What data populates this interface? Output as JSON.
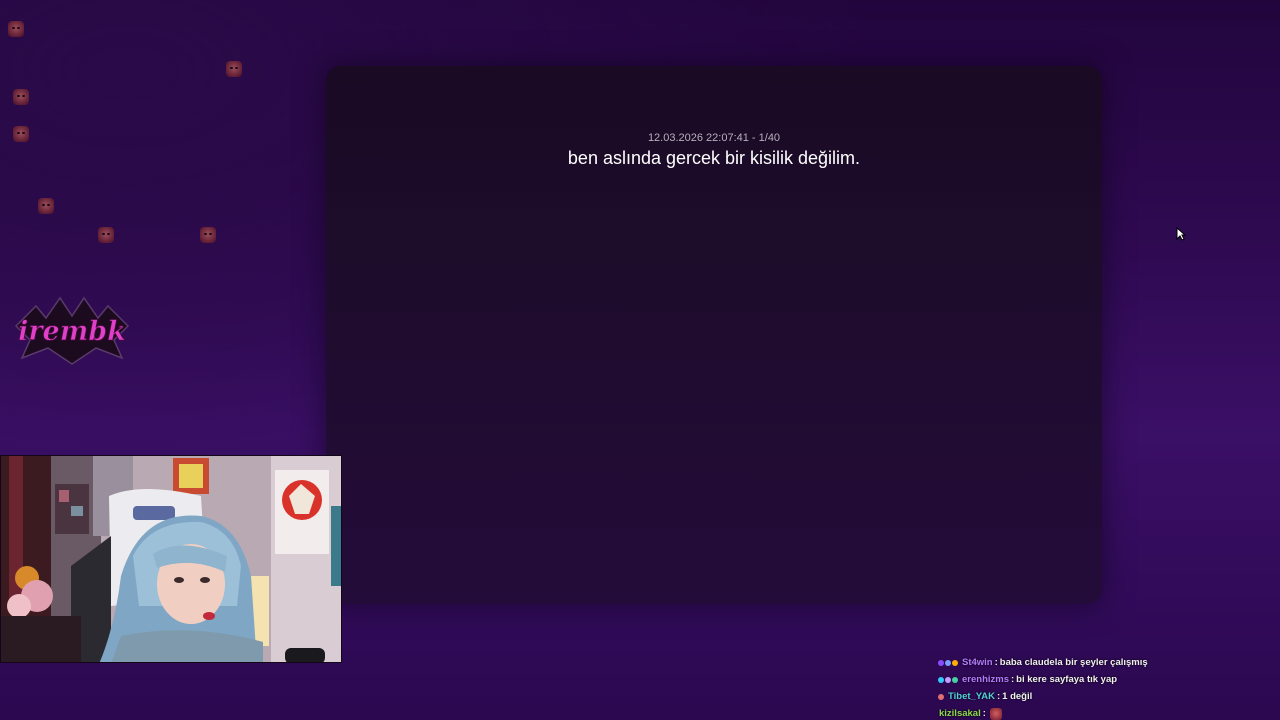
{
  "overlay": {
    "logo_text": "irembk",
    "emotes": [
      "emote-red-face"
    ]
  },
  "panel": {
    "meta": "12.03.2026 22:07:41 - 1/40",
    "message": "ben aslında gercek bir kisilik değilim."
  },
  "colors": {
    "background": "#2f0a52",
    "panel": "#1e0c2c",
    "logo": "#e040c8"
  },
  "chat": {
    "messages": [
      {
        "user": "St4win",
        "user_color": "#b47bff",
        "badges": [
          "#8a4dff",
          "#7aa0ff",
          "#ffb000"
        ],
        "separator": ":",
        "text": "baba claudela bir şeyler çalışmış"
      },
      {
        "user": "erenhizms",
        "user_color": "#b47bff",
        "badges": [
          "#35c9ff",
          "#c0a0ff",
          "#48d0a0"
        ],
        "separator": ":",
        "text": "bi kere sayfaya tık yap"
      },
      {
        "user": "Tibet_YAK",
        "user_color": "#4fd0d8",
        "badges": [
          "#e07070"
        ],
        "separator": ":",
        "text": "1 değil"
      },
      {
        "user": "kizilsakal",
        "user_color": "#8cd84a",
        "badges": [],
        "separator": ":",
        "text": ""
      }
    ]
  }
}
